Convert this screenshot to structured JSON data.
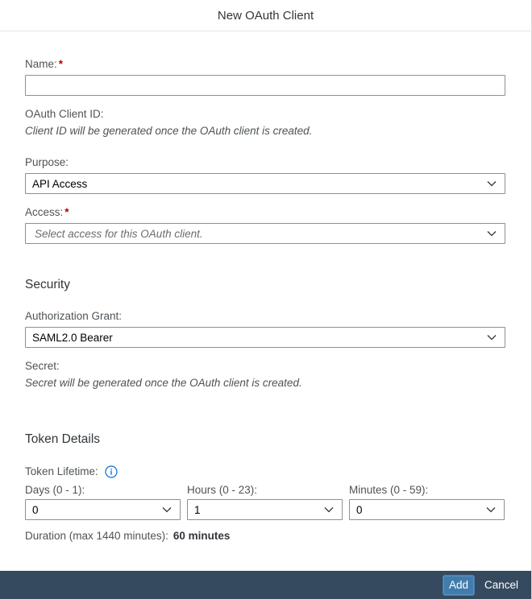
{
  "dialog": {
    "title": "New OAuth Client"
  },
  "form": {
    "name": {
      "label": "Name:",
      "required_mark": "*",
      "value": "",
      "placeholder": ""
    },
    "client_id": {
      "label": "OAuth Client ID:",
      "hint": "Client ID will be generated once the OAuth client is created."
    },
    "purpose": {
      "label": "Purpose:",
      "value": "API Access"
    },
    "access": {
      "label": "Access:",
      "required_mark": "*",
      "placeholder": "Select access for this OAuth client."
    }
  },
  "security": {
    "title": "Security",
    "grant": {
      "label": "Authorization Grant:",
      "value": "SAML2.0 Bearer"
    },
    "secret": {
      "label": "Secret:",
      "hint": "Secret will be generated once the OAuth client is created."
    }
  },
  "token": {
    "title": "Token Details",
    "lifetime_label": "Token Lifetime:",
    "days": {
      "label": "Days (0 - 1):",
      "value": "0"
    },
    "hours": {
      "label": "Hours (0 - 23):",
      "value": "1"
    },
    "minutes": {
      "label": "Minutes (0 - 59):",
      "value": "0"
    },
    "duration_label": "Duration (max 1440 minutes):",
    "duration_value": "60 minutes"
  },
  "footer": {
    "add_label": "Add",
    "cancel_label": "Cancel"
  },
  "icons": {
    "dropdown": "chevron-down-icon",
    "info": "info-icon"
  },
  "colors": {
    "primary_button": "#427cac",
    "footer_bg": "#354a5f",
    "required": "#bb0000",
    "info_icon": "#0a6ed1"
  }
}
